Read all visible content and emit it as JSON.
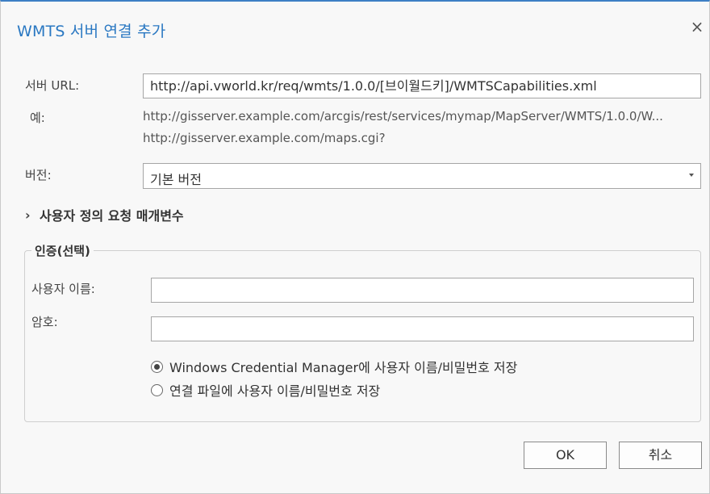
{
  "dialog": {
    "title": "WMTS 서버 연결 추가",
    "close_label": "×"
  },
  "server_url": {
    "label": "서버 URL:",
    "value": "http://api.vworld.kr/req/wmts/1.0.0/[브이월드키]/WMTSCapabilities.xml"
  },
  "examples": {
    "label": "예:",
    "lines": [
      "http://gisserver.example.com/arcgis/rest/services/mymap/MapServer/WMTS/1.0.0/W...",
      "http://gisserver.example.com/maps.cgi?"
    ]
  },
  "version": {
    "label": "버전:",
    "selected": "기본 버전"
  },
  "custom_params": {
    "label": "사용자 정의 요청 매개변수",
    "chevron": "›"
  },
  "auth": {
    "legend": "인증(선택)",
    "username_label": "사용자 이름:",
    "username_value": "",
    "password_label": "암호:",
    "password_value": "",
    "options": [
      {
        "label": "Windows Credential Manager에 사용자 이름/비밀번호 저장",
        "selected": true
      },
      {
        "label": "연결 파일에 사용자 이름/비밀번호 저장",
        "selected": false
      }
    ]
  },
  "buttons": {
    "ok": "OK",
    "cancel": "취소"
  },
  "colors": {
    "accent": "#2a78c2",
    "background": "#f8f8f8"
  }
}
